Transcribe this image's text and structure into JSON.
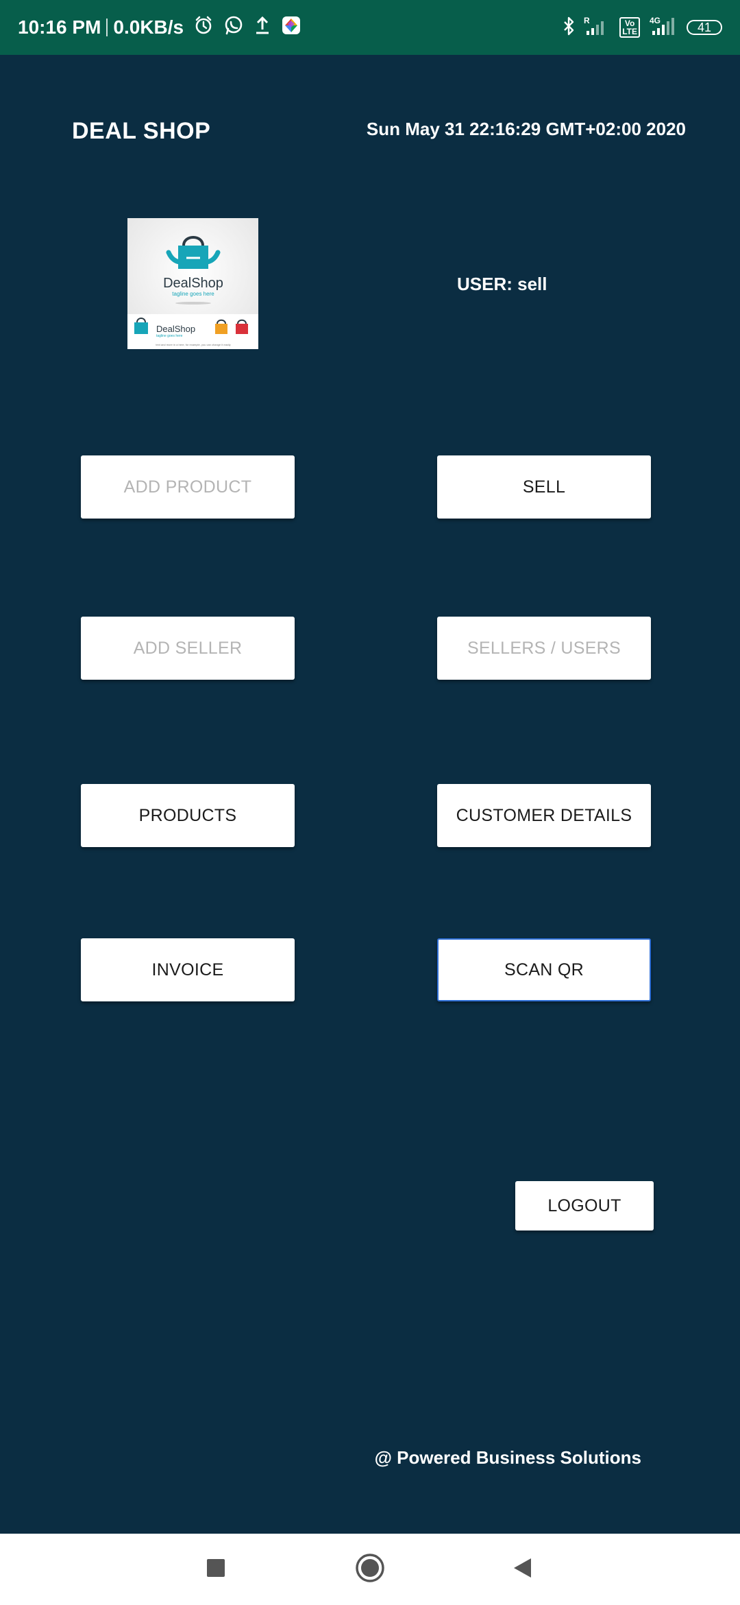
{
  "status_bar": {
    "time": "10:16 PM",
    "net_speed": "0.0KB/s",
    "battery": "41",
    "volte": "Vo\nLTE",
    "net_type": "4G",
    "roaming": "R"
  },
  "header": {
    "title": "DEAL SHOP",
    "datetime": "Sun May 31 22:16:29 GMT+02:00 2020"
  },
  "logo": {
    "brand": "DealShop",
    "tagline": "tagline goes here",
    "footer_text": "text and more in a here, for example, you can change it easily"
  },
  "user": {
    "label": "USER: sell"
  },
  "buttons": {
    "add_product": "ADD PRODUCT",
    "sell": "SELL",
    "add_seller": "ADD SELLER",
    "sellers_users": "SELLERS / USERS",
    "products": "PRODUCTS",
    "customer_details": "CUSTOMER DETAILS",
    "invoice": "INVOICE",
    "scan_qr": "SCAN QR",
    "logout": "LOGOUT"
  },
  "footer": {
    "text": "@ Powered Business Solutions"
  },
  "colors": {
    "background": "#0b2d42",
    "status_bar": "#075e4b",
    "button": "#ffffff",
    "disabled_text": "#b4b4b4",
    "focus_border": "#2f6fd6"
  },
  "icons": {
    "status": [
      "alarm-icon",
      "whatsapp-icon",
      "upload-icon",
      "photos-icon",
      "bluetooth-icon",
      "signal-icon",
      "battery-icon"
    ],
    "nav": [
      "recents-icon",
      "home-icon",
      "back-icon"
    ]
  }
}
